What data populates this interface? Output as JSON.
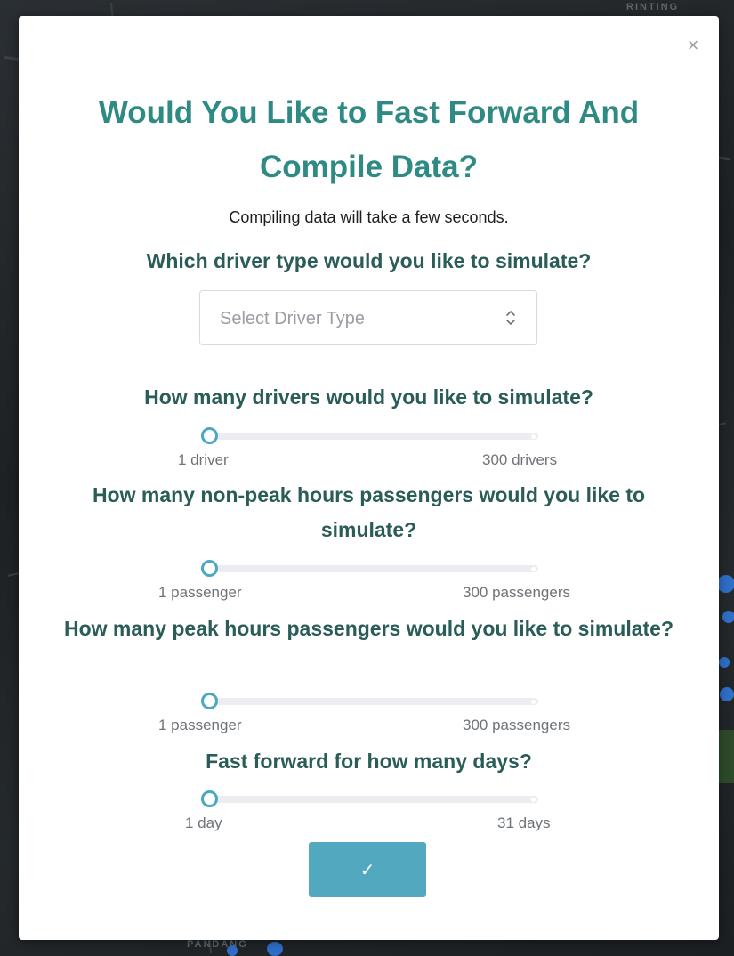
{
  "background": {
    "labels": [
      "RINTING",
      "PANDANG"
    ]
  },
  "modal": {
    "close_symbol": "×",
    "title": "Would You Like to Fast Forward And Compile Data?",
    "subtitle": "Compiling data will take a few seconds.",
    "driver_type": {
      "question": "Which driver type would you like to simulate?",
      "select_placeholder": "Select Driver Type"
    },
    "drivers": {
      "question": "How many drivers would you like to simulate?",
      "min_label": "1 driver",
      "max_label": "300 drivers",
      "value": 1
    },
    "nonpeak": {
      "question": "How many non-peak hours passengers would you like to simulate?",
      "min_label": "1 passenger",
      "max_label": "300 passengers",
      "value": 1
    },
    "peak": {
      "question": "How many peak hours passengers would you like to simulate?",
      "min_label": "1 passenger",
      "max_label": "300 passengers",
      "value": 1
    },
    "days": {
      "question": "Fast forward for how many days?",
      "min_label": "1 day",
      "max_label": "31 days",
      "value": 1
    },
    "submit_symbol": "✓"
  },
  "colors": {
    "title": "#2f8a84",
    "question": "#2a5c58",
    "accent": "#52a9bf",
    "slider_thumb": "#4aa8c2"
  },
  "icons": {
    "close": "close-icon",
    "select": "chevron-up-down-icon",
    "submit": "checkmark-icon"
  }
}
